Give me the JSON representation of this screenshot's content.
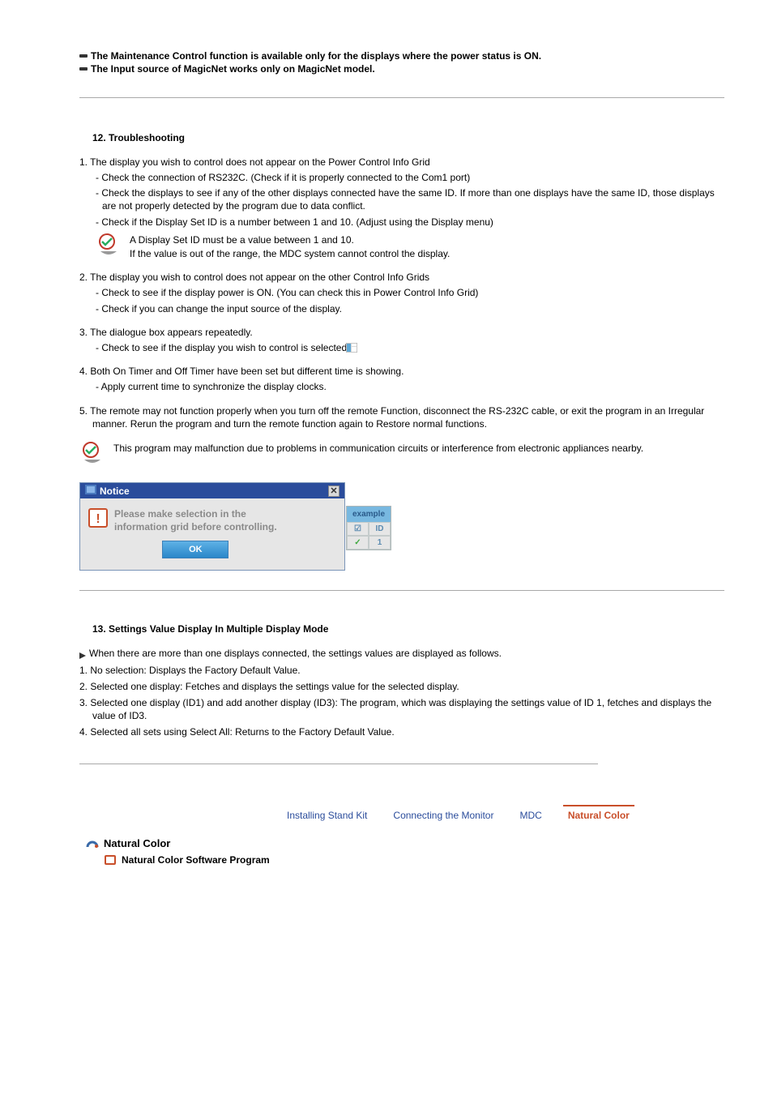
{
  "top_notes": {
    "line1": "The Maintenance Control function is available only for the displays where the power status is ON.",
    "line2": "The Input source of MagicNet works only on MagicNet model."
  },
  "s12": {
    "title": "12. Troubleshooting",
    "items": [
      {
        "lead": "1. The display you wish to control does not appear on the Power Control Info Grid",
        "subs": [
          "- Check the connection of RS232C. (Check if it is properly connected to the Com1 port)",
          "- Check the displays to see if any of the other displays connected have the same ID. If more than one displays have the same ID, those displays are not properly detected by the program due to data conflict.",
          "- Check if the Display Set ID is a number between 1 and 10. (Adjust using the Display menu)"
        ],
        "info": "A Display Set ID must be a value between 1 and 10.\nIf the value is out of the range, the MDC system cannot control the display."
      },
      {
        "lead": "2.  The display you wish to control does not appear on the other Control Info Grids",
        "subs": [
          "- Check to see if the display power is ON. (You can check this in Power Control Info Grid)",
          "- Check if you can change the input source of the display."
        ]
      },
      {
        "lead": "3.  The dialogue box appears repeatedly.",
        "subs": [
          "- Check to see if the display you wish to control is selected."
        ],
        "trailing_icon": true
      },
      {
        "lead": "4.  Both On Timer and Off Timer have been set but different time is showing.",
        "subs": [
          "- Apply current time to synchronize the display clocks."
        ]
      },
      {
        "lead": "5.  The remote may not function properly when you turn off the remote Function, disconnect the RS-232C cable, or exit the program in an Irregular manner. Rerun the program and turn the remote function again to Restore normal functions."
      }
    ],
    "info2": "This program may malfunction due to problems in communication circuits or interference from electronic appliances nearby."
  },
  "notice": {
    "title": "Notice",
    "msg_line1": "Please make selection in the",
    "msg_line2": "information grid before controlling.",
    "ok": "OK",
    "example_label": "example",
    "col_check": "☑",
    "col_id": "ID",
    "val_check": "✓",
    "val_id": "1"
  },
  "s13": {
    "title": "13. Settings Value Display In Multiple Display Mode",
    "lead": "When there are more than one displays connected, the settings values are displayed as follows.",
    "items": [
      "1.  No selection: Displays the Factory Default Value.",
      "2.  Selected one display: Fetches and displays the settings value for the selected display.",
      "3.  Selected one display (ID1) and add another display (ID3): The program, which was displaying the settings value of ID 1, fetches and displays the value of ID3.",
      "4.  Selected all sets using Select All: Returns to the Factory Default Value."
    ]
  },
  "nav": {
    "t1": "Installing Stand Kit",
    "t2": "Connecting the Monitor",
    "t3": "MDC",
    "t4": "Natural Color"
  },
  "nc": {
    "title": "Natural Color",
    "sub": "Natural Color Software Program"
  }
}
